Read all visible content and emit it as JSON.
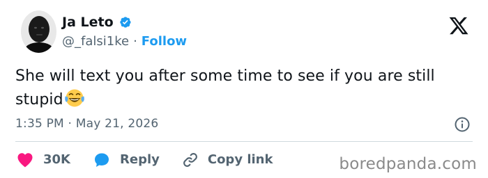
{
  "author": {
    "display_name": "Ja Leto",
    "handle": "@_falsi1ke",
    "separator": "·",
    "follow_label": "Follow",
    "verified_color": "#1d9bf0"
  },
  "tweet": {
    "text": "She will text you after some time to see if you are still stupid",
    "emoji": "face-with-tears-of-joy"
  },
  "timestamp": {
    "time": "1:35 PM",
    "separator": "·",
    "date": "May 21, 2026"
  },
  "actions": {
    "like_count": "30K",
    "reply_label": "Reply",
    "copy_link_label": "Copy link"
  },
  "watermark": "boredpanda.com",
  "colors": {
    "accent": "#1d9bf0",
    "like": "#f91880",
    "text": "#0f1419",
    "secondary": "#536471"
  }
}
